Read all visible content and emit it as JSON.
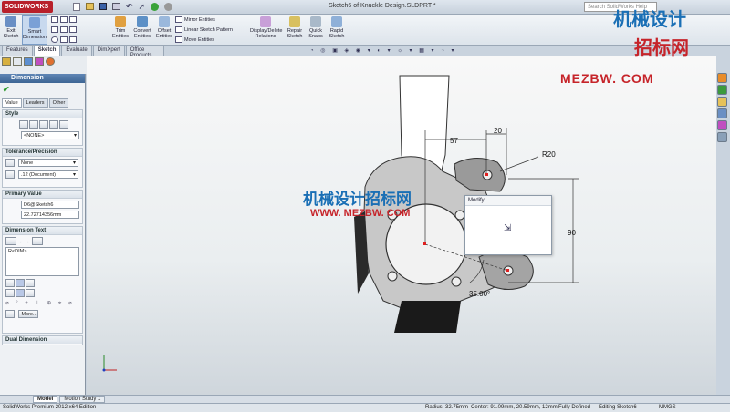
{
  "app": {
    "name": "SOLIDWORKS",
    "doc_title": "Sketch6 of Knuckle Design.SLDPRT *",
    "search_placeholder": "Search SolidWorks Help"
  },
  "ribbon": {
    "exit_sketch": "Exit Sketch",
    "smart_dimension": "Smart Dimension",
    "trim_entities": "Trim Entities",
    "convert_entities": "Convert Entities",
    "offset_entities": "Offset Entities",
    "mirror_entities": "Mirror Entities",
    "linear_sketch_pattern": "Linear Sketch Pattern",
    "move_entities": "Move Entities",
    "display_delete_relations": "Display/Delete Relations",
    "repair_sketch": "Repair Sketch",
    "quick_snaps": "Quick Snaps",
    "rapid_sketch": "Rapid Sketch"
  },
  "command_tabs": [
    "Features",
    "Sketch",
    "Evaluate",
    "DimXpert",
    "Office Products"
  ],
  "property_manager": {
    "title": "Dimension",
    "tabs": [
      "Value",
      "Leaders",
      "Other"
    ],
    "style": {
      "heading": "Style",
      "value": "<NONE>"
    },
    "tolerance": {
      "heading": "Tolerance/Precision",
      "type": "None",
      "precision": ".12 (Document)"
    },
    "primary_value": {
      "heading": "Primary Value",
      "name": "D6@Sketch6",
      "value": "22.72714356mm"
    },
    "dimension_text": {
      "heading": "Dimension Text",
      "text": "R<DIM>",
      "more_button": "More..."
    },
    "dual_dimension": "Dual Dimension"
  },
  "drawing": {
    "dims": {
      "d57": "57",
      "d20": "20",
      "r20": "R20",
      "d90": "90",
      "angle": "35.00°"
    }
  },
  "modify_dialog": {
    "title": "Modify"
  },
  "watermark": {
    "line1": "机械设计",
    "line2": "招标网",
    "url": "MEZBW. COM",
    "center_cn": "机械设计招标网",
    "center_url": "WWW. MEZBW. COM"
  },
  "bottom_tabs": [
    "Model",
    "Motion Study 1"
  ],
  "status": {
    "edition": "SolidWorks Premium 2012 x64 Edition",
    "radius": "Radius: 32.75mm",
    "center": "Center: 91.09mm, 20.59mm, 12mm",
    "state": "Fully Defined",
    "editing": "Editing Sketch6",
    "units": "MMGS"
  },
  "colors": {
    "accent": "#3d6594",
    "brand_red": "#b8202a",
    "part_gray": "#bfbfbf",
    "part_dark": "#1a1a1a"
  }
}
